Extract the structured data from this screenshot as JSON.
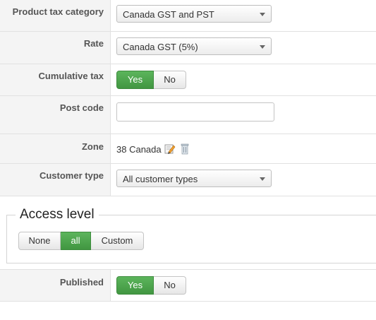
{
  "fields": {
    "product_tax_category": {
      "label": "Product tax category",
      "value": "Canada GST and PST"
    },
    "rate": {
      "label": "Rate",
      "value": "Canada GST (5%)"
    },
    "cumulative_tax": {
      "label": "Cumulative tax",
      "yes": "Yes",
      "no": "No",
      "selected": "Yes"
    },
    "post_code": {
      "label": "Post code",
      "value": ""
    },
    "zone": {
      "label": "Zone",
      "value": "38 Canada",
      "edit_icon": "pencil-edit-icon",
      "delete_icon": "trash-delete-icon"
    },
    "customer_type": {
      "label": "Customer type",
      "value": "All customer types"
    }
  },
  "access_level": {
    "legend": "Access level",
    "options": [
      "None",
      "all",
      "Custom"
    ],
    "selected": "all"
  },
  "published": {
    "label": "Published",
    "yes": "Yes",
    "no": "No",
    "selected": "Yes"
  },
  "colors": {
    "accent_green": "#47a447",
    "label_bg": "#f4f4f4",
    "border": "#e1e1e1"
  }
}
